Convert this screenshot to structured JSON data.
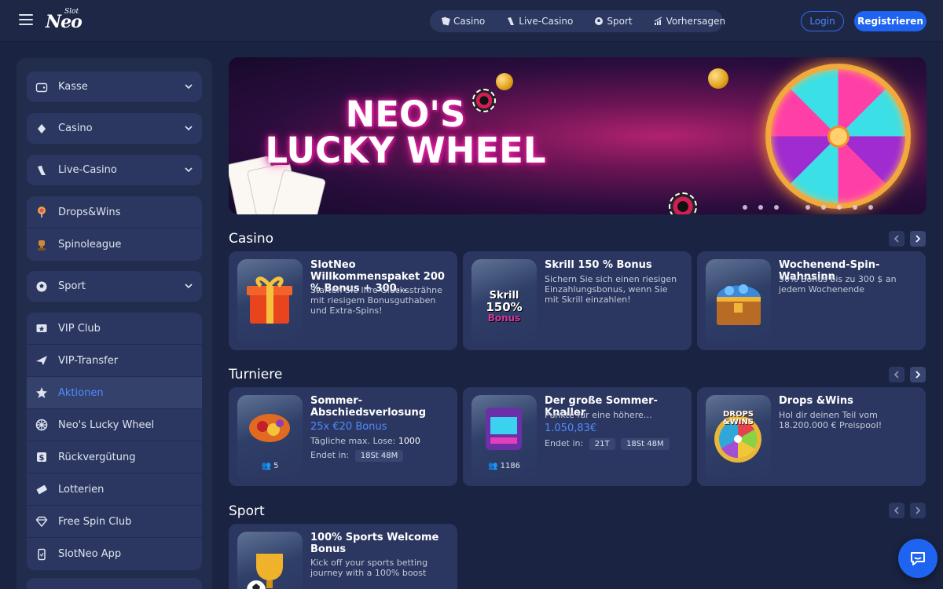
{
  "header": {
    "logo_small": "Slot",
    "logo_main": "Neo",
    "nav": [
      {
        "label": "Casino",
        "icon": "cards-icon"
      },
      {
        "label": "Live-Casino",
        "icon": "dealer-hand-icon"
      },
      {
        "label": "Sport",
        "icon": "soccer-ball-icon"
      },
      {
        "label": "Vorhersagen",
        "icon": "chart-icon"
      }
    ],
    "login_label": "Login",
    "register_label": "Registrieren"
  },
  "sidebar": {
    "dropdowns": [
      {
        "label": "Kasse",
        "icon": "wallet-icon"
      },
      {
        "label": "Casino",
        "icon": "cards-icon"
      },
      {
        "label": "Live-Casino",
        "icon": "dealer-hand-icon"
      }
    ],
    "group1": [
      {
        "label": "Drops&Wins",
        "icon": "lollipop-icon"
      },
      {
        "label": "Spinoleague",
        "icon": "trophy-icon"
      }
    ],
    "sport": {
      "label": "Sport",
      "icon": "soccer-ball-icon"
    },
    "group2": [
      {
        "label": "VIP Club",
        "icon": "vip-icon"
      },
      {
        "label": "VIP-Transfer",
        "icon": "plane-icon"
      },
      {
        "label": "Aktionen",
        "icon": "star-badge-icon",
        "active": true
      },
      {
        "label": "Neo's Lucky Wheel",
        "icon": "wheel-icon"
      },
      {
        "label": "Rückvergütung",
        "icon": "dollar-icon"
      },
      {
        "label": "Lotterien",
        "icon": "ticket-icon"
      },
      {
        "label": "Free Spin Club",
        "icon": "diamond-icon"
      },
      {
        "label": "SlotNeo App",
        "icon": "phone-icon"
      }
    ]
  },
  "banner": {
    "title_line1": "NEO'S",
    "title_line2": "LUCKY WHEEL",
    "slides": 8,
    "active_slide": 3
  },
  "sections": {
    "casino": {
      "title": "Casino",
      "cards": [
        {
          "title": "SlotNeo Willkommenspaket 200 % Bonus + 300…",
          "desc": "Starten Sie Ihre Glückssträhne mit riesigem Bonusguthaben und Extra-Spins!",
          "thumb": "gift-icon"
        },
        {
          "title": "Skrill 150 % Bonus",
          "desc": "Sichern Sie sich einen riesigen Einzahlungsbonus, wenn Sie mit Skrill einzahlen!",
          "thumb_line1": "Skrill",
          "thumb_line2": "150%",
          "thumb_line3": "Bonus"
        },
        {
          "title": "Wochenend-Spin-Wahnsinn",
          "desc": "50% Bonus bis zu 300 $ an jedem Wochenende",
          "thumb": "treasure-chest-icon"
        }
      ]
    },
    "turniere": {
      "title": "Turniere",
      "cards": [
        {
          "title": "Sommer-Abschiedsverlosung",
          "amount": "25x €20 Bonus",
          "meta_label": "Tägliche max. Lose:",
          "meta_value": "1000",
          "ends_label": "Endet in:",
          "pills": [
            "18St 48M"
          ],
          "players": "5"
        },
        {
          "title": "Der große Sommer-Knaller",
          "desc": "Punkte für eine höhere…",
          "amount": "1.050,83€",
          "ends_label": "Endet in:",
          "pills": [
            "21T",
            "18St 48M"
          ],
          "players": "1186"
        },
        {
          "title": "Drops &Wins",
          "desc": "Hol dir deinen Teil vom 18.200.000 € Preispool!",
          "thumb_line1": "DROPS",
          "thumb_line2": "&WINS"
        }
      ]
    },
    "sport": {
      "title": "Sport",
      "cards": [
        {
          "title": "100% Sports Welcome Bonus",
          "desc": "Kick off your sports betting journey with a 100% boost"
        }
      ]
    }
  },
  "colors": {
    "background": "#1a2341",
    "panel": "#2b3760",
    "accent": "#1f64f0",
    "active_text": "#4f8bff"
  }
}
